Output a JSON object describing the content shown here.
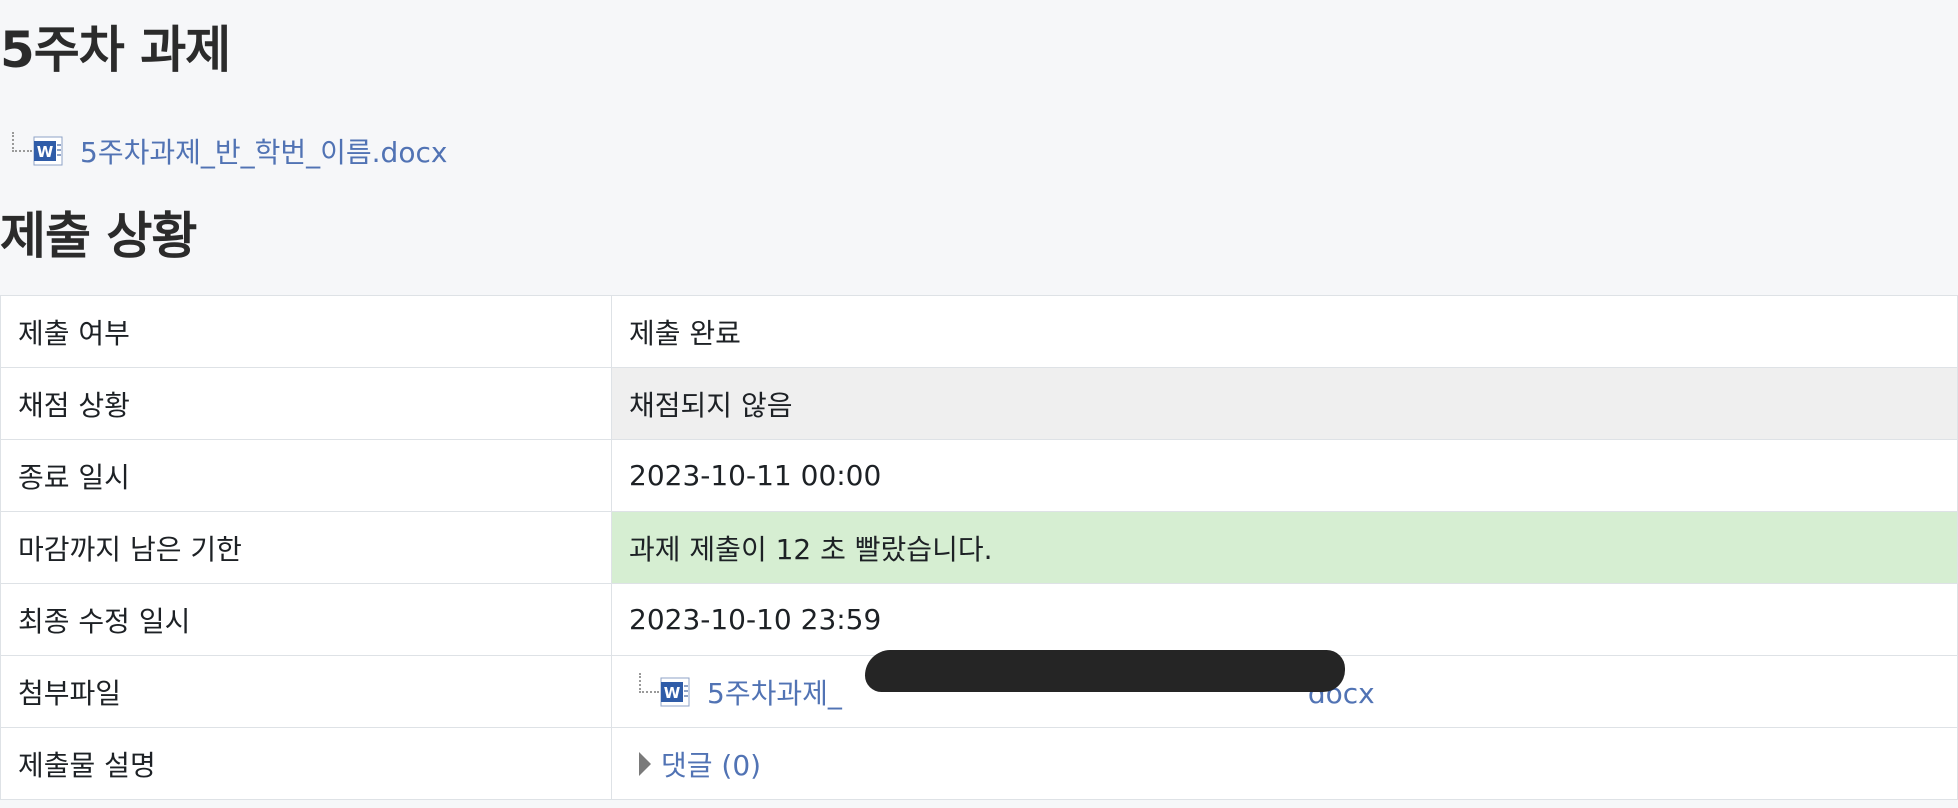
{
  "page": {
    "title": "5주차 과제",
    "intro_file": {
      "name": "5주차과제_반_학번_이름.docx",
      "icon": "word-document-icon"
    },
    "section_title": "제출 상황"
  },
  "status_table": {
    "rows": [
      {
        "label": "제출 여부",
        "value": "제출 완료"
      },
      {
        "label": "채점 상황",
        "value": "채점되지 않음"
      },
      {
        "label": "종료 일시",
        "value": "2023-10-11 00:00"
      },
      {
        "label": "마감까지 남은 기한",
        "value": "과제 제출이 12 초 빨랐습니다."
      },
      {
        "label": "최종 수정 일시",
        "value": "2023-10-10 23:59"
      },
      {
        "label": "첨부파일",
        "file_prefix": "5주차과제_",
        "file_suffix": "docx",
        "icon": "word-document-icon"
      },
      {
        "label": "제출물 설명",
        "comments": "댓글 (0)"
      }
    ]
  },
  "colors": {
    "link": "#5173b4",
    "submitted": "#3f7f2f",
    "grading_bg": "#efefef",
    "remaining_bg": "#d6eed2",
    "page_bg": "#f6f7f9"
  }
}
